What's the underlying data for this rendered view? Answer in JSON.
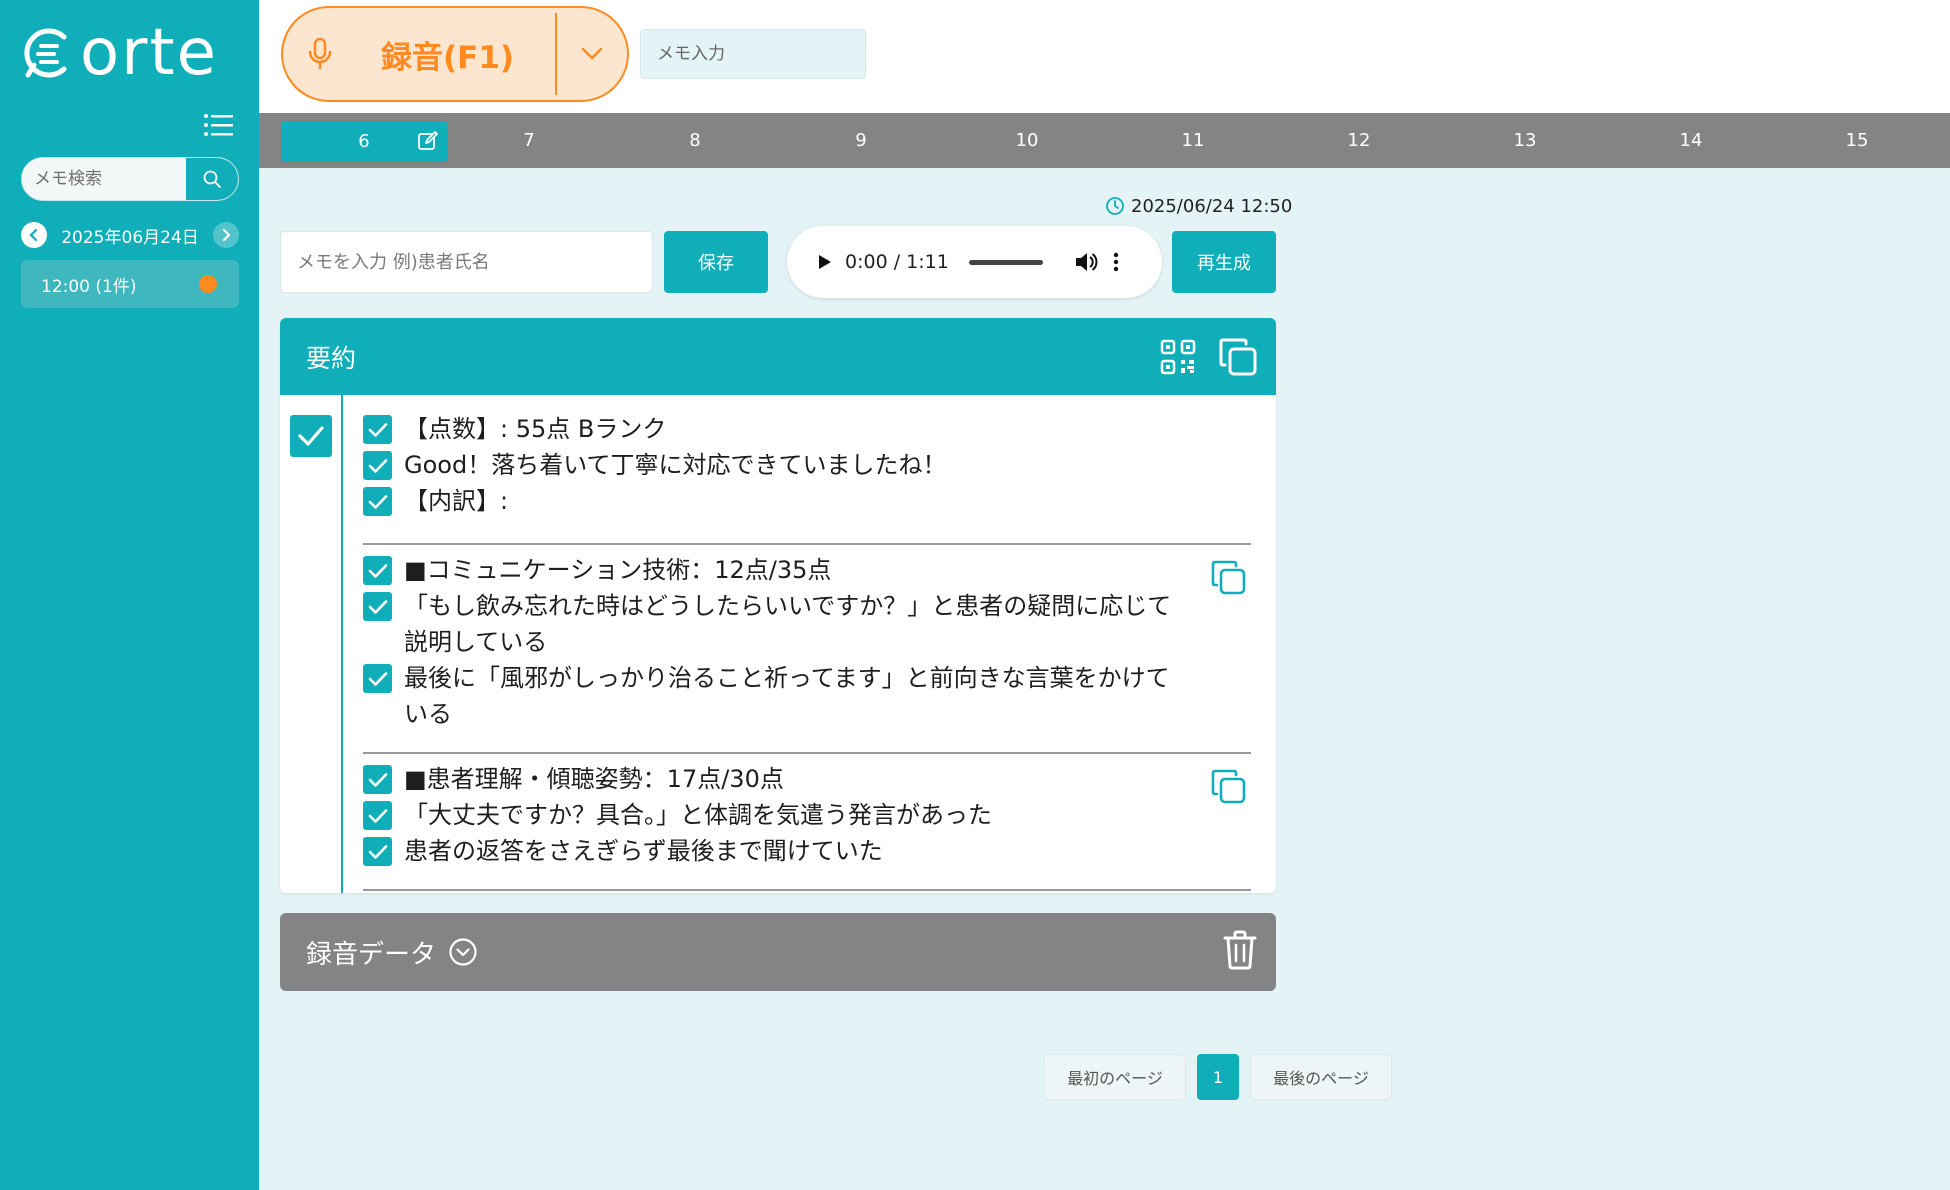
{
  "app": {
    "logo_text": "orte"
  },
  "sidebar": {
    "search_placeholder": "メモ検索",
    "date_label": "2025年06月24日",
    "time_items": [
      {
        "label": "12:00 (1件)"
      }
    ]
  },
  "header": {
    "record_label": "録音(F1)",
    "memo_placeholder": "メモ入力"
  },
  "hour_tabs": [
    "6",
    "7",
    "8",
    "9",
    "10",
    "11",
    "12",
    "13",
    "14",
    "15"
  ],
  "active_hour": "6",
  "entry": {
    "timestamp": "2025/06/24 12:50",
    "memo_placeholder": "メモを入力 例)患者氏名",
    "save_label": "保存",
    "audio_time": "0:00 / 1:11",
    "regenerate_label": "再生成"
  },
  "summary": {
    "title": "要約",
    "sections": [
      {
        "lines": [
          "【点数】: 55点 Bランク",
          "Good！落ち着いて丁寧に対応できていましたね！",
          "【内訳】:"
        ]
      },
      {
        "lines": [
          "■コミュニケーション技術：12点/35点",
          "「もし飲み忘れた時はどうしたらいいですか？」と患者の疑問に応じて説明している",
          "最後に「風邪がしっかり治ること祈ってます」と前向きな言葉をかけている"
        ]
      },
      {
        "lines": [
          "■患者理解・傾聴姿勢：17点/30点",
          "「大丈夫ですか？具合。」と体調を気遣う発言があった",
          "患者の返答をさえぎらず最後まで聞けていた"
        ]
      }
    ]
  },
  "recording_data": {
    "label": "録音データ"
  },
  "pagination": {
    "first_label": "最初のページ",
    "current": "1",
    "last_label": "最後のページ"
  },
  "colors": {
    "primary": "#10aeb9",
    "accent": "#ff8a1f",
    "gray_bar": "#848484",
    "page_bg": "#e4f3f6"
  }
}
